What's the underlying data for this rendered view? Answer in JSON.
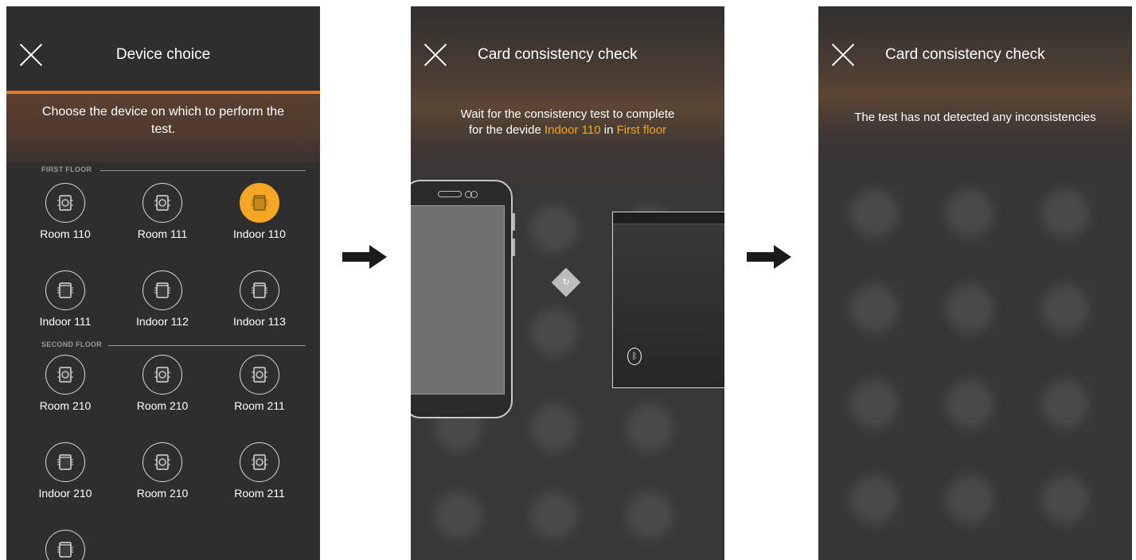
{
  "screen1": {
    "title": "Device choice",
    "instruction": "Choose the device on which to perform the test.",
    "sections": [
      {
        "label": "FIRST FLOOR",
        "devices": [
          {
            "name": "Room 110",
            "type": "room",
            "selected": false
          },
          {
            "name": "Room 111",
            "type": "room",
            "selected": false
          },
          {
            "name": "Indoor 110",
            "type": "indoor",
            "selected": true
          },
          {
            "name": "Indoor 111",
            "type": "indoor",
            "selected": false
          },
          {
            "name": "Indoor 112",
            "type": "indoor",
            "selected": false
          },
          {
            "name": "Indoor 113",
            "type": "indoor",
            "selected": false
          }
        ]
      },
      {
        "label": "SECOND FLOOR",
        "devices": [
          {
            "name": "Room 210",
            "type": "room",
            "selected": false
          },
          {
            "name": "Room 210",
            "type": "room",
            "selected": false
          },
          {
            "name": "Room 211",
            "type": "room",
            "selected": false
          },
          {
            "name": "Indoor 210",
            "type": "indoor",
            "selected": false
          },
          {
            "name": "Room 210",
            "type": "room",
            "selected": false
          },
          {
            "name": "Room 211",
            "type": "room",
            "selected": false
          },
          {
            "name": "",
            "type": "indoor",
            "selected": false
          }
        ]
      }
    ]
  },
  "screen2": {
    "title": "Card consistency check",
    "msg_line1": "Wait for the consistency test to complete",
    "msg_prefix": "for the devide ",
    "device_name": "Indoor 110",
    "msg_mid": " in ",
    "floor_name": "First floor"
  },
  "screen3": {
    "title": "Card consistency check",
    "message": "The test has not detected any inconsistencies"
  },
  "colors": {
    "accent": "#f5a623",
    "orange_line": "#ef7c22",
    "background": "#2e2e2e"
  }
}
